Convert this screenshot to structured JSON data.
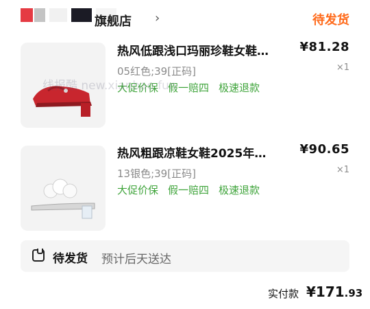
{
  "shop": {
    "name": "旗舰店",
    "status": "待发货"
  },
  "watermark": "线报酷 new.xianbao.fun",
  "items": [
    {
      "title": "热风低跟浅口玛丽珍鞋女鞋…",
      "price": "¥81.28",
      "spec": "05红色;39[正码]",
      "qty": "×1",
      "services": [
        "大促价保",
        "假一赔四",
        "极速退款"
      ]
    },
    {
      "title": "热风粗跟凉鞋女鞋2025年…",
      "price": "¥90.65",
      "spec": "13银色;39[正码]",
      "qty": "×1",
      "services": [
        "大促价保",
        "假一赔四",
        "极速退款"
      ]
    }
  ],
  "shipping": {
    "status": "待发货",
    "eta": "预计后天送达"
  },
  "total": {
    "label": "实付款",
    "currency": "¥",
    "integer": "171",
    "decimal": ".93"
  },
  "colors": {
    "accent": "#ff6a1a",
    "service_green": "#3fa43b"
  }
}
